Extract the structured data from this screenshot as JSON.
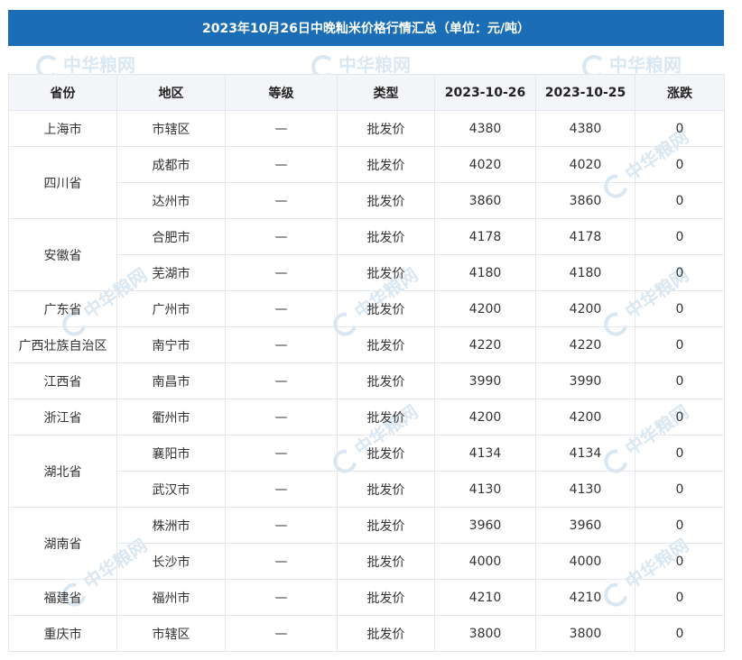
{
  "title": "2023年10月26日中晚籼米价格行情汇总（单位：元/吨）",
  "watermark": "中华粮网",
  "headers": [
    "省份",
    "地区",
    "等级",
    "类型",
    "2023-10-26",
    "2023-10-25",
    "涨跌"
  ],
  "rows": [
    {
      "province": "上海市",
      "region": "市辖区",
      "grade": "—",
      "type": "批发价",
      "today": "4380",
      "prev": "4380",
      "change": "0"
    },
    {
      "province": "四川省",
      "region": "成都市",
      "grade": "—",
      "type": "批发价",
      "today": "4020",
      "prev": "4020",
      "change": "0"
    },
    {
      "province": "",
      "region": "达州市",
      "grade": "—",
      "type": "批发价",
      "today": "3860",
      "prev": "3860",
      "change": "0"
    },
    {
      "province": "安徽省",
      "region": "合肥市",
      "grade": "—",
      "type": "批发价",
      "today": "4178",
      "prev": "4178",
      "change": "0"
    },
    {
      "province": "",
      "region": "芜湖市",
      "grade": "—",
      "type": "批发价",
      "today": "4180",
      "prev": "4180",
      "change": "0"
    },
    {
      "province": "广东省",
      "region": "广州市",
      "grade": "—",
      "type": "批发价",
      "today": "4200",
      "prev": "4200",
      "change": "0"
    },
    {
      "province": "广西壮族自治区",
      "region": "南宁市",
      "grade": "—",
      "type": "批发价",
      "today": "4220",
      "prev": "4220",
      "change": "0"
    },
    {
      "province": "江西省",
      "region": "南昌市",
      "grade": "—",
      "type": "批发价",
      "today": "3990",
      "prev": "3990",
      "change": "0"
    },
    {
      "province": "浙江省",
      "region": "衢州市",
      "grade": "—",
      "type": "批发价",
      "today": "4200",
      "prev": "4200",
      "change": "0"
    },
    {
      "province": "湖北省",
      "region": "襄阳市",
      "grade": "—",
      "type": "批发价",
      "today": "4134",
      "prev": "4134",
      "change": "0"
    },
    {
      "province": "",
      "region": "武汉市",
      "grade": "—",
      "type": "批发价",
      "today": "4130",
      "prev": "4130",
      "change": "0"
    },
    {
      "province": "湖南省",
      "region": "株洲市",
      "grade": "—",
      "type": "批发价",
      "today": "3960",
      "prev": "3960",
      "change": "0"
    },
    {
      "province": "",
      "region": "长沙市",
      "grade": "—",
      "type": "批发价",
      "today": "4000",
      "prev": "4000",
      "change": "0"
    },
    {
      "province": "福建省",
      "region": "福州市",
      "grade": "—",
      "type": "批发价",
      "today": "4210",
      "prev": "4210",
      "change": "0"
    },
    {
      "province": "重庆市",
      "region": "市辖区",
      "grade": "—",
      "type": "批发价",
      "today": "3800",
      "prev": "3800",
      "change": "0"
    }
  ]
}
